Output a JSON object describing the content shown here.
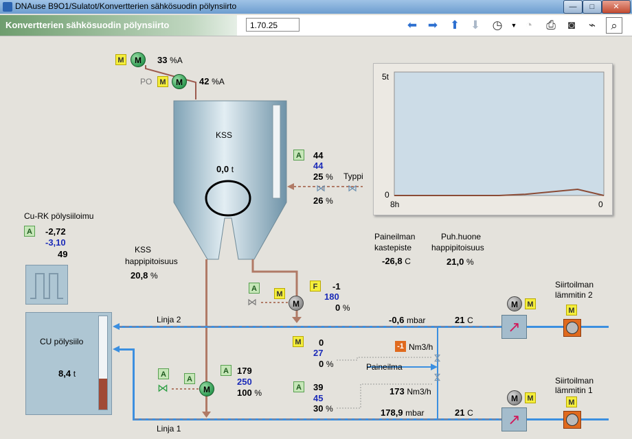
{
  "window": {
    "title": "DNAuse B9O1/Sulatot/Konvertterien sähkösuodin pölynsiirto"
  },
  "header": {
    "title": "Konvertterien sähkösuodin pölynsiirto",
    "version_value": "1.70.25"
  },
  "toolbar": {
    "icons": [
      "arrow-left-icon",
      "arrow-right-icon",
      "arrow-up-icon",
      "arrow-down-icon",
      "history-icon",
      "gauge-icon",
      "print-icon",
      "camera-icon",
      "trend-icon",
      "zoom-icon"
    ]
  },
  "motors_top": {
    "m1_badge": "M",
    "m1_symbol": "M",
    "m1_value": "33",
    "m1_unit": "%A",
    "po_label": "PO",
    "m2_badge": "M",
    "m2_symbol": "M",
    "m2_value": "42",
    "m2_unit": "%A"
  },
  "silo_kss": {
    "label": "KSS",
    "value": "0,0",
    "unit": "t"
  },
  "valve_typpi": {
    "badge": "A",
    "v1": "44",
    "v2": "44",
    "v3": "25",
    "v3_unit": "%",
    "v4": "26",
    "v4_unit": "%",
    "label": "Typpi"
  },
  "chart_data": {
    "type": "area",
    "y_tick_top": "5t",
    "y_tick_bottom": "0",
    "x_tick_left": "8h",
    "x_tick_right": "0",
    "x": [
      0,
      1,
      2,
      3,
      4,
      5,
      6,
      7,
      8
    ],
    "values": [
      0,
      0,
      0,
      0,
      0,
      0.05,
      0.15,
      0.25,
      0
    ],
    "ylim": [
      0,
      5
    ],
    "colors": {
      "fill": "#c9d8e4",
      "line": "#8b4b35"
    }
  },
  "cu_rk": {
    "label": "Cu-RK pölysiiloimu",
    "badge": "A",
    "v1": "-2,72",
    "v2": "-3,10",
    "v3": "49"
  },
  "kss_oxygen": {
    "label_line1": "KSS",
    "label_line2": "happipitoisuus",
    "value": "20,8",
    "unit": "%"
  },
  "pressure_air": {
    "label_line1": "Paineilman",
    "label_line2": "kastepiste",
    "value": "-26,8",
    "unit": "C"
  },
  "room_oxygen": {
    "label_line1": "Puh.huone",
    "label_line2": "happipitoisuus",
    "value": "21,0",
    "unit": "%"
  },
  "cu_silo": {
    "label": "CU pölysiilo",
    "value": "8,4",
    "unit": "t",
    "level_pct": 33
  },
  "valve_kss_out": {
    "badge_a": "A",
    "badge_m": "M",
    "motor_symbol": "M",
    "badge_f": "F",
    "v1": "-1",
    "v2": "180",
    "v3": "0",
    "v3_unit": "%"
  },
  "linja2": {
    "label": "Linja 2",
    "pressure": "-0,6",
    "pressure_unit": "mbar",
    "temp": "21",
    "temp_unit": "C"
  },
  "linja1": {
    "label": "Linja 1",
    "pressure": "178,9",
    "pressure_unit": "mbar",
    "temp": "21",
    "temp_unit": "C"
  },
  "ctrl_m": {
    "badge": "M",
    "v1": "0",
    "v2": "27",
    "v3": "0",
    "v3_unit": "%"
  },
  "flow_top": {
    "value": "-1",
    "unit": "Nm3/h"
  },
  "paineilma": {
    "label": "Paineilma"
  },
  "ctrl_a2": {
    "badge": "A",
    "v1": "39",
    "v2": "45",
    "v3": "30",
    "v3_unit": "%"
  },
  "flow_bottom": {
    "value": "173",
    "unit": "Nm3/h"
  },
  "valve_bottom": {
    "badge_a1": "A",
    "badge_a2": "A",
    "motor_symbol": "M",
    "badge_a3": "A",
    "v1": "179",
    "v2": "250",
    "v3": "100",
    "v3_unit": "%"
  },
  "heater2": {
    "label_line1": "Siirtoilman",
    "label_line2": "lämmitin 2",
    "motor_symbol": "M",
    "badge_m": "M",
    "badge_m2": "M"
  },
  "heater1": {
    "label_line1": "Siirtoilman",
    "label_line2": "lämmitin 1",
    "motor_symbol": "M",
    "badge_m": "M",
    "badge_m2": "M"
  }
}
